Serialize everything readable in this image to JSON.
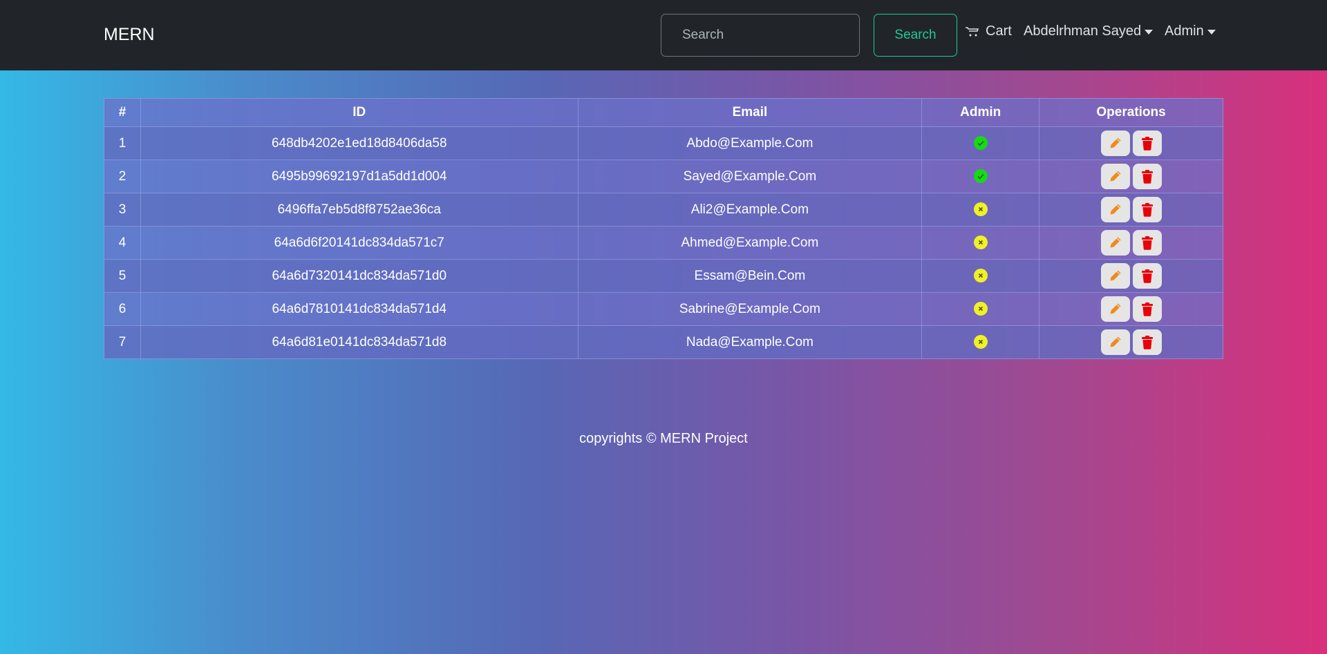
{
  "navbar": {
    "brand": "MERN",
    "search_placeholder": "Search",
    "search_button": "Search",
    "cart_label": "Cart",
    "user_label": "Abdelrhman Sayed",
    "admin_label": "Admin"
  },
  "table": {
    "headers": [
      "#",
      "ID",
      "Email",
      "Admin",
      "Operations"
    ],
    "rows": [
      {
        "num": "1",
        "id": "648db4202e1ed18d8406da58",
        "email": "Abdo@Example.Com",
        "admin": true
      },
      {
        "num": "2",
        "id": "6495b99692197d1a5dd1d004",
        "email": "Sayed@Example.Com",
        "admin": true
      },
      {
        "num": "3",
        "id": "6496ffa7eb5d8f8752ae36ca",
        "email": "Ali2@Example.Com",
        "admin": false
      },
      {
        "num": "4",
        "id": "64a6d6f20141dc834da571c7",
        "email": "Ahmed@Example.Com",
        "admin": false
      },
      {
        "num": "5",
        "id": "64a6d7320141dc834da571d0",
        "email": "Essam@Bein.Com",
        "admin": false
      },
      {
        "num": "6",
        "id": "64a6d7810141dc834da571d4",
        "email": "Sabrine@Example.Com",
        "admin": false
      },
      {
        "num": "7",
        "id": "64a6d81e0141dc834da571d8",
        "email": "Nada@Example.Com",
        "admin": false
      }
    ]
  },
  "icons": {
    "admin_yes": "check-circle-icon",
    "admin_no": "x-circle-icon",
    "edit": "pencil-icon",
    "delete": "trash-icon",
    "cart": "cart-icon"
  },
  "colors": {
    "navbar_bg": "#212529",
    "search_accent": "#20c997",
    "admin_yes": "#19d719",
    "admin_no": "#f0f028",
    "edit_icon": "#f08a1c",
    "delete_icon": "#e8000b"
  },
  "footer": {
    "text": "copyrights © MERN Project"
  }
}
